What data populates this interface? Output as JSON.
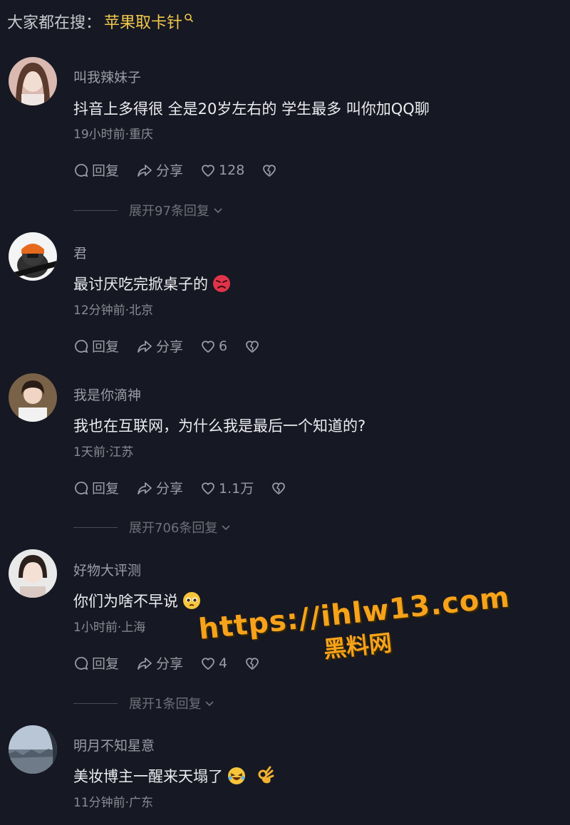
{
  "search_hint": {
    "prefix": "大家都在搜：",
    "keyword": "苹果取卡针"
  },
  "comments": [
    {
      "username": "叫我辣妹子",
      "content": "抖音上多得很 全是20岁左右的 学生最多 叫你加QQ聊",
      "meta": "19小时前·重庆",
      "reply_label": "回复",
      "share_label": "分享",
      "likes": "128",
      "expand": "展开97条回复"
    },
    {
      "username": "君",
      "content": "最讨厌吃完掀桌子的",
      "emoji": "angry-face",
      "meta": "12分钟前·北京",
      "reply_label": "回复",
      "share_label": "分享",
      "likes": "6"
    },
    {
      "username": "我是你滴神",
      "content": "我也在互联网，为什么我是最后一个知道的?",
      "meta": "1天前·江苏",
      "reply_label": "回复",
      "share_label": "分享",
      "likes": "1.1万",
      "expand": "展开706条回复"
    },
    {
      "username": "好物大评测",
      "content": "你们为啥不早说",
      "emoji": "pleading-face",
      "meta": "1小时前·上海",
      "reply_label": "回复",
      "share_label": "分享",
      "likes": "4",
      "expand": "展开1条回复"
    },
    {
      "username": "明月不知星意",
      "content": "美妆博主一醒来天塌了",
      "emoji": "laughing-face ok-hand",
      "meta": "11分钟前·广东"
    }
  ],
  "watermark": {
    "url": "https://ihlw13.com",
    "name": "黑料网"
  }
}
